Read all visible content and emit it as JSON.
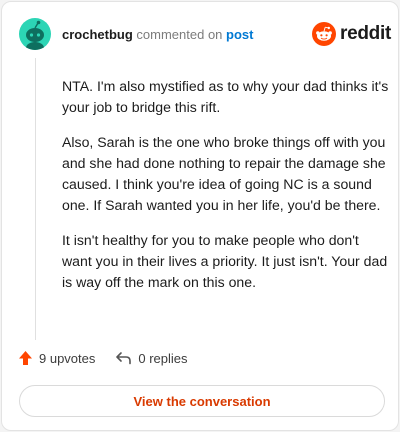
{
  "comment": {
    "username": "crochetbug",
    "action_text": "commented on",
    "post_link": "post",
    "paragraphs": [
      "NTA. I'm also mystified as to why your dad thinks it's your job to bridge this rift.",
      "Also, Sarah is the one who broke things off with you and she had done nothing to repair the damage she caused. I think you're idea of going NC is a sound one. If Sarah wanted you in her life, you'd be there.",
      "It isn't healthy for you to make people who don't want you in their lives a priority. It just isn't. Your dad is way off the mark on this one."
    ],
    "upvotes_label": "9 upvotes",
    "replies_label": "0 replies"
  },
  "brand": {
    "name": "reddit"
  },
  "cta": {
    "label": "View the conversation"
  },
  "colors": {
    "avatar": "#2cd5b5",
    "brand_orange": "#ff4500",
    "link_blue": "#0079d3",
    "cta_text": "#d93a00"
  },
  "icons": {
    "avatar": "snoo-avatar-icon",
    "brand": "reddit-logo-icon",
    "upvote": "upvote-arrow-icon",
    "reply": "reply-arrow-icon"
  }
}
